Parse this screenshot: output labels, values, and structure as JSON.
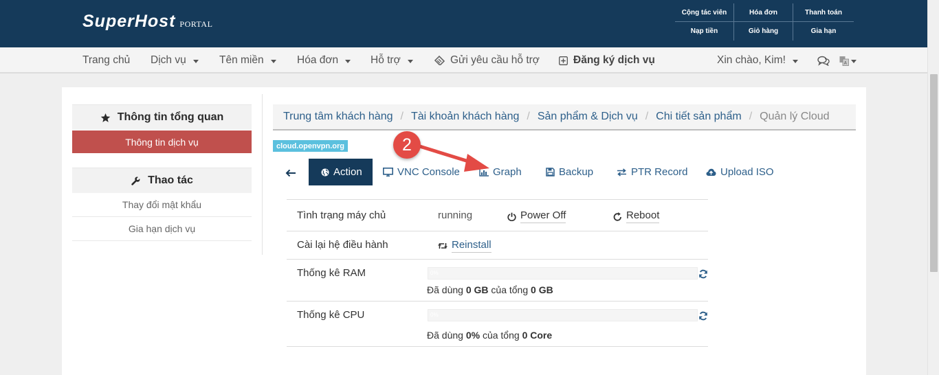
{
  "header": {
    "logo": "SuperHost",
    "logo_sub": "PORTAL",
    "links": [
      "Cộng tác viên",
      "Hóa đơn",
      "Thanh toán",
      "Nạp tiền",
      "Giỏ hàng",
      "Gia hạn"
    ]
  },
  "nav": {
    "home": "Trang chủ",
    "services": "Dịch vụ",
    "domains": "Tên miền",
    "invoices": "Hóa đơn",
    "support": "Hỗ trợ",
    "ticket": "Gửi yêu cầu hỗ trợ",
    "register": "Đăng ký dịch vụ",
    "greeting": "Xin chào, Kim!"
  },
  "sidebar": {
    "overview_title": "Thông tin tổng quan",
    "overview_item": "Thông tin dịch vụ",
    "actions_title": "Thao tác",
    "actions": [
      "Thay đổi mật khẩu",
      "Gia hạn dịch vụ"
    ]
  },
  "breadcrumb": [
    "Trung tâm khách hàng",
    "Tài khoản khách hàng",
    "Sản phẩm & Dịch vụ",
    "Chi tiết sản phẩm",
    "Quản lý Cloud"
  ],
  "hostname_tag": "cloud.openvpn.org",
  "tabs": {
    "action": "Action",
    "vnc": "VNC Console",
    "graph": "Graph",
    "backup": "Backup",
    "ptr": "PTR Record",
    "upload": "Upload ISO"
  },
  "details": {
    "server_status_label": "Tình trạng máy chủ",
    "server_status_value": "running",
    "power_off": "Power Off",
    "reboot": "Reboot",
    "reinstall_label": "Cài lại hệ điều hành",
    "reinstall": "Reinstall",
    "ram_label": "Thống kê RAM",
    "ram_bar_text": "0%",
    "ram_usage_prefix": "Đã dùng",
    "ram_used": "0 GB",
    "ram_mid": "của tổng",
    "ram_total": "0 GB",
    "ram_percent": 0,
    "cpu_label": "Thống kê CPU",
    "cpu_bar_text": "0%",
    "cpu_usage_prefix": "Đã dùng",
    "cpu_used": "0%",
    "cpu_mid": "của tổng",
    "cpu_total": "0 Core",
    "cpu_percent": 0
  },
  "annotation": {
    "step": "2"
  },
  "colors": {
    "header_bg": "#153a5a",
    "active_sidebar": "#c0504d",
    "link": "#2d5f8a",
    "annotation": "#e34b45"
  }
}
